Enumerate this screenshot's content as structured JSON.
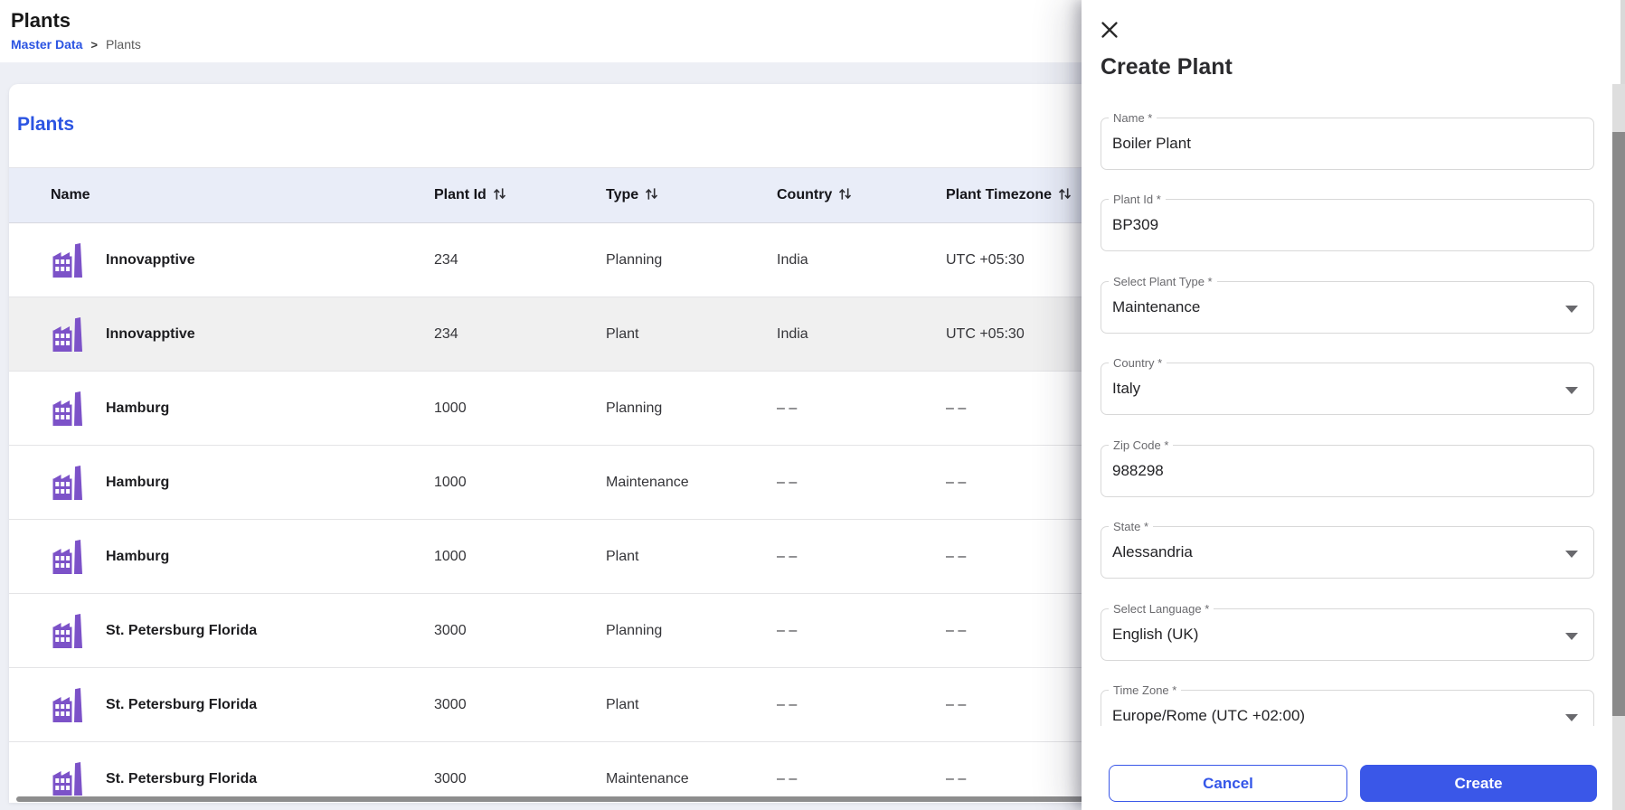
{
  "page": {
    "title": "Plants",
    "breadcrumb": {
      "parent": "Master Data",
      "separator": ">",
      "current": "Plants"
    }
  },
  "table": {
    "title": "Plants",
    "sort_icon": "sort-arrows-icon",
    "columns": [
      {
        "label": "Name",
        "sortable": false
      },
      {
        "label": "Plant Id",
        "sortable": true
      },
      {
        "label": "Type",
        "sortable": true
      },
      {
        "label": "Country",
        "sortable": true
      },
      {
        "label": "Plant Timezone",
        "sortable": true
      }
    ],
    "rows": [
      {
        "icon": "factory-icon",
        "name": "Innovapptive",
        "plant_id": "234",
        "type": "Planning",
        "country": "India",
        "timezone": "UTC +05:30",
        "highlighted": false
      },
      {
        "icon": "factory-icon",
        "name": "Innovapptive",
        "plant_id": "234",
        "type": "Plant",
        "country": "India",
        "timezone": "UTC +05:30",
        "highlighted": true
      },
      {
        "icon": "factory-icon",
        "name": "Hamburg",
        "plant_id": "1000",
        "type": "Planning",
        "country": "– –",
        "timezone": "– –",
        "highlighted": false
      },
      {
        "icon": "factory-icon",
        "name": "Hamburg",
        "plant_id": "1000",
        "type": "Maintenance",
        "country": "– –",
        "timezone": "– –",
        "highlighted": false
      },
      {
        "icon": "factory-icon",
        "name": "Hamburg",
        "plant_id": "1000",
        "type": "Plant",
        "country": "– –",
        "timezone": "– –",
        "highlighted": false
      },
      {
        "icon": "factory-icon",
        "name": "St. Petersburg Florida",
        "plant_id": "3000",
        "type": "Planning",
        "country": "– –",
        "timezone": "– –",
        "highlighted": false
      },
      {
        "icon": "factory-icon",
        "name": "St. Petersburg Florida",
        "plant_id": "3000",
        "type": "Plant",
        "country": "– –",
        "timezone": "– –",
        "highlighted": false
      },
      {
        "icon": "factory-icon",
        "name": "St. Petersburg Florida",
        "plant_id": "3000",
        "type": "Maintenance",
        "country": "– –",
        "timezone": "– –",
        "highlighted": false
      }
    ]
  },
  "drawer": {
    "title": "Create Plant",
    "close_icon": "close-icon",
    "fields": [
      {
        "label": "Name *",
        "value": "Boiler Plant",
        "type": "text"
      },
      {
        "label": "Plant Id *",
        "value": "BP309",
        "type": "text"
      },
      {
        "label": "Select Plant Type *",
        "value": "Maintenance",
        "type": "select"
      },
      {
        "label": "Country *",
        "value": "Italy",
        "type": "select"
      },
      {
        "label": "Zip Code *",
        "value": "988298",
        "type": "text"
      },
      {
        "label": "State *",
        "value": "Alessandria",
        "type": "select"
      },
      {
        "label": "Select Language *",
        "value": "English (UK)",
        "type": "select"
      },
      {
        "label": "Time Zone *",
        "value": "Europe/Rome (UTC +02:00)",
        "type": "select"
      }
    ],
    "buttons": {
      "cancel": "Cancel",
      "create": "Create"
    }
  },
  "colors": {
    "accent_blue": "#2b54e2",
    "button_blue": "#3a57e8",
    "icon_purple": "#7c52c8",
    "header_row_bg": "#e9edf8",
    "row_highlight_bg": "#f0f0f0",
    "scrollbar_thumb": "#8a8a8a"
  }
}
